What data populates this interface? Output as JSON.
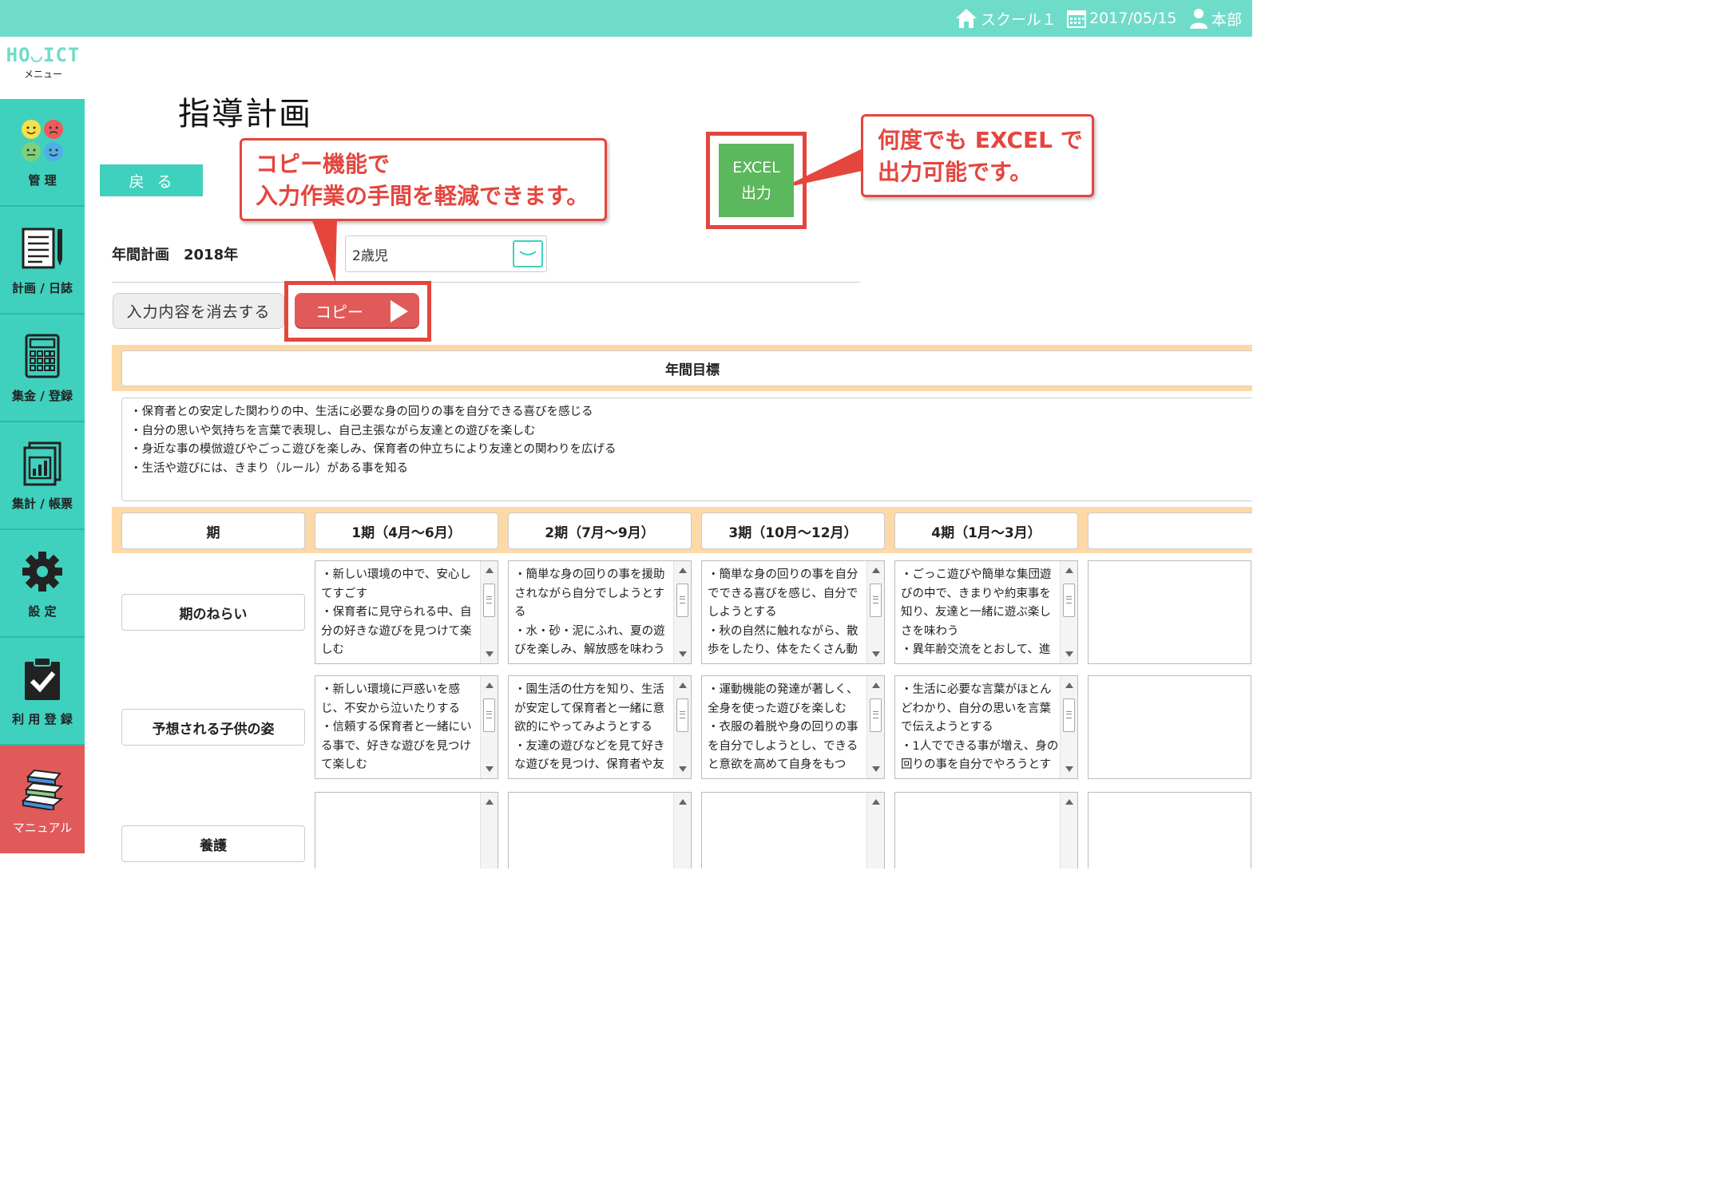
{
  "header": {
    "school": "スクール１",
    "date": "2017/05/15",
    "user": "本部"
  },
  "logo": {
    "text": "HO◡ICT",
    "sub": "メニュー"
  },
  "sidebar": {
    "items": [
      {
        "label": "管 理",
        "icon": "faces-icon"
      },
      {
        "label": "計画 / 日誌",
        "icon": "notebook-pen-icon"
      },
      {
        "label": "集金 / 登録",
        "icon": "calculator-icon"
      },
      {
        "label": "集計 / 帳票",
        "icon": "report-chart-icon"
      },
      {
        "label": "設 定",
        "icon": "gear-icon"
      },
      {
        "label": "利 用 登 録",
        "icon": "clipboard-check-icon"
      },
      {
        "label": "マニュアル",
        "icon": "books-icon"
      }
    ]
  },
  "page": {
    "title": "指導計画",
    "back_label": "戻る"
  },
  "callouts": {
    "copy": [
      "コピー機能で",
      "入力作業の手間を軽減できます。"
    ],
    "excel": [
      "何度でも EXCEL で",
      "出力可能です。"
    ]
  },
  "excel_button": {
    "line1": "EXCEL",
    "line2": "出力"
  },
  "plan": {
    "label": "年間計画　2018年",
    "class_select": "2歳児"
  },
  "actions": {
    "clear_label": "入力内容を消去する",
    "copy_label": "コピー"
  },
  "annual_goal": {
    "title": "年間目標",
    "lines": [
      "・保育者との安定した関わりの中、生活に必要な身の回りの事を自分できる喜びを感じる",
      "・自分の思いや気持ちを言葉で表現し、自己主張ながら友達との遊びを楽しむ",
      "・身近な事の模倣遊びやごっこ遊びを楽しみ、保育者の仲立ちにより友達との関わりを広げる",
      "・生活や遊びには、きまり（ルール）がある事を知る"
    ]
  },
  "periods": {
    "header_label": "期",
    "columns": [
      "1期（4月〜6月）",
      "2期（7月〜9月）",
      "3期（10月〜12月）",
      "4期（1月〜3月）",
      ""
    ]
  },
  "rows": [
    {
      "label": "期のねらい",
      "cells": [
        [
          "・新しい環境の中で、安心し",
          "てすごす",
          "・保育者に見守られる中、自",
          "分の好きな遊びを見つけて楽",
          "しむ"
        ],
        [
          "・簡単な身の回りの事を援助",
          "されながら自分でしようとす",
          "る",
          "・水・砂・泥にふれ、夏の遊",
          "びを楽しみ、解放感を味わう"
        ],
        [
          "・簡単な身の回りの事を自分",
          "でできる喜びを感じ、自分で",
          "しようとする",
          "・秋の自然に触れながら、散",
          "歩をしたり、体をたくさん動"
        ],
        [
          "・ごっこ遊びや簡単な集団遊",
          "びの中で、きまりや約束事を",
          "知り、友達と一緒に遊ぶ楽し",
          "さを味わう",
          "・異年齢交流をとおして、進"
        ]
      ]
    },
    {
      "label": "予想される子供の姿",
      "cells": [
        [
          "・新しい環境に戸惑いを感",
          "じ、不安から泣いたりする",
          "・信頼する保育者と一緒にい",
          "る事で、好きな遊びを見つけ",
          "て楽しむ"
        ],
        [
          "・園生活の仕方を知り、生活",
          "が安定して保育者と一緒に意",
          "欲的にやってみようとする",
          "・友達の遊びなどを見て好き",
          "な遊びを見つけ、保育者や友"
        ],
        [
          "・運動機能の発達が著しく、",
          "全身を使った遊びを楽しむ",
          "・衣服の着脱や身の回りの事",
          "を自分でしようとし、できる",
          "と意欲を高めて自身をもつ"
        ],
        [
          "・生活に必要な言葉がほとん",
          "どわかり、自分の思いを言葉",
          "で伝えようとする",
          "・1人でできる事が増え、身の",
          "回りの事を自分でやろうとす"
        ]
      ]
    },
    {
      "label": "養護",
      "cells": [
        [],
        [],
        [],
        []
      ]
    }
  ],
  "colors": {
    "teal": "#3fd1bd",
    "topbar": "#6fdcc9",
    "red": "#e4463e",
    "band": "#fcd9a6",
    "excel_green": "#5cb85c"
  }
}
